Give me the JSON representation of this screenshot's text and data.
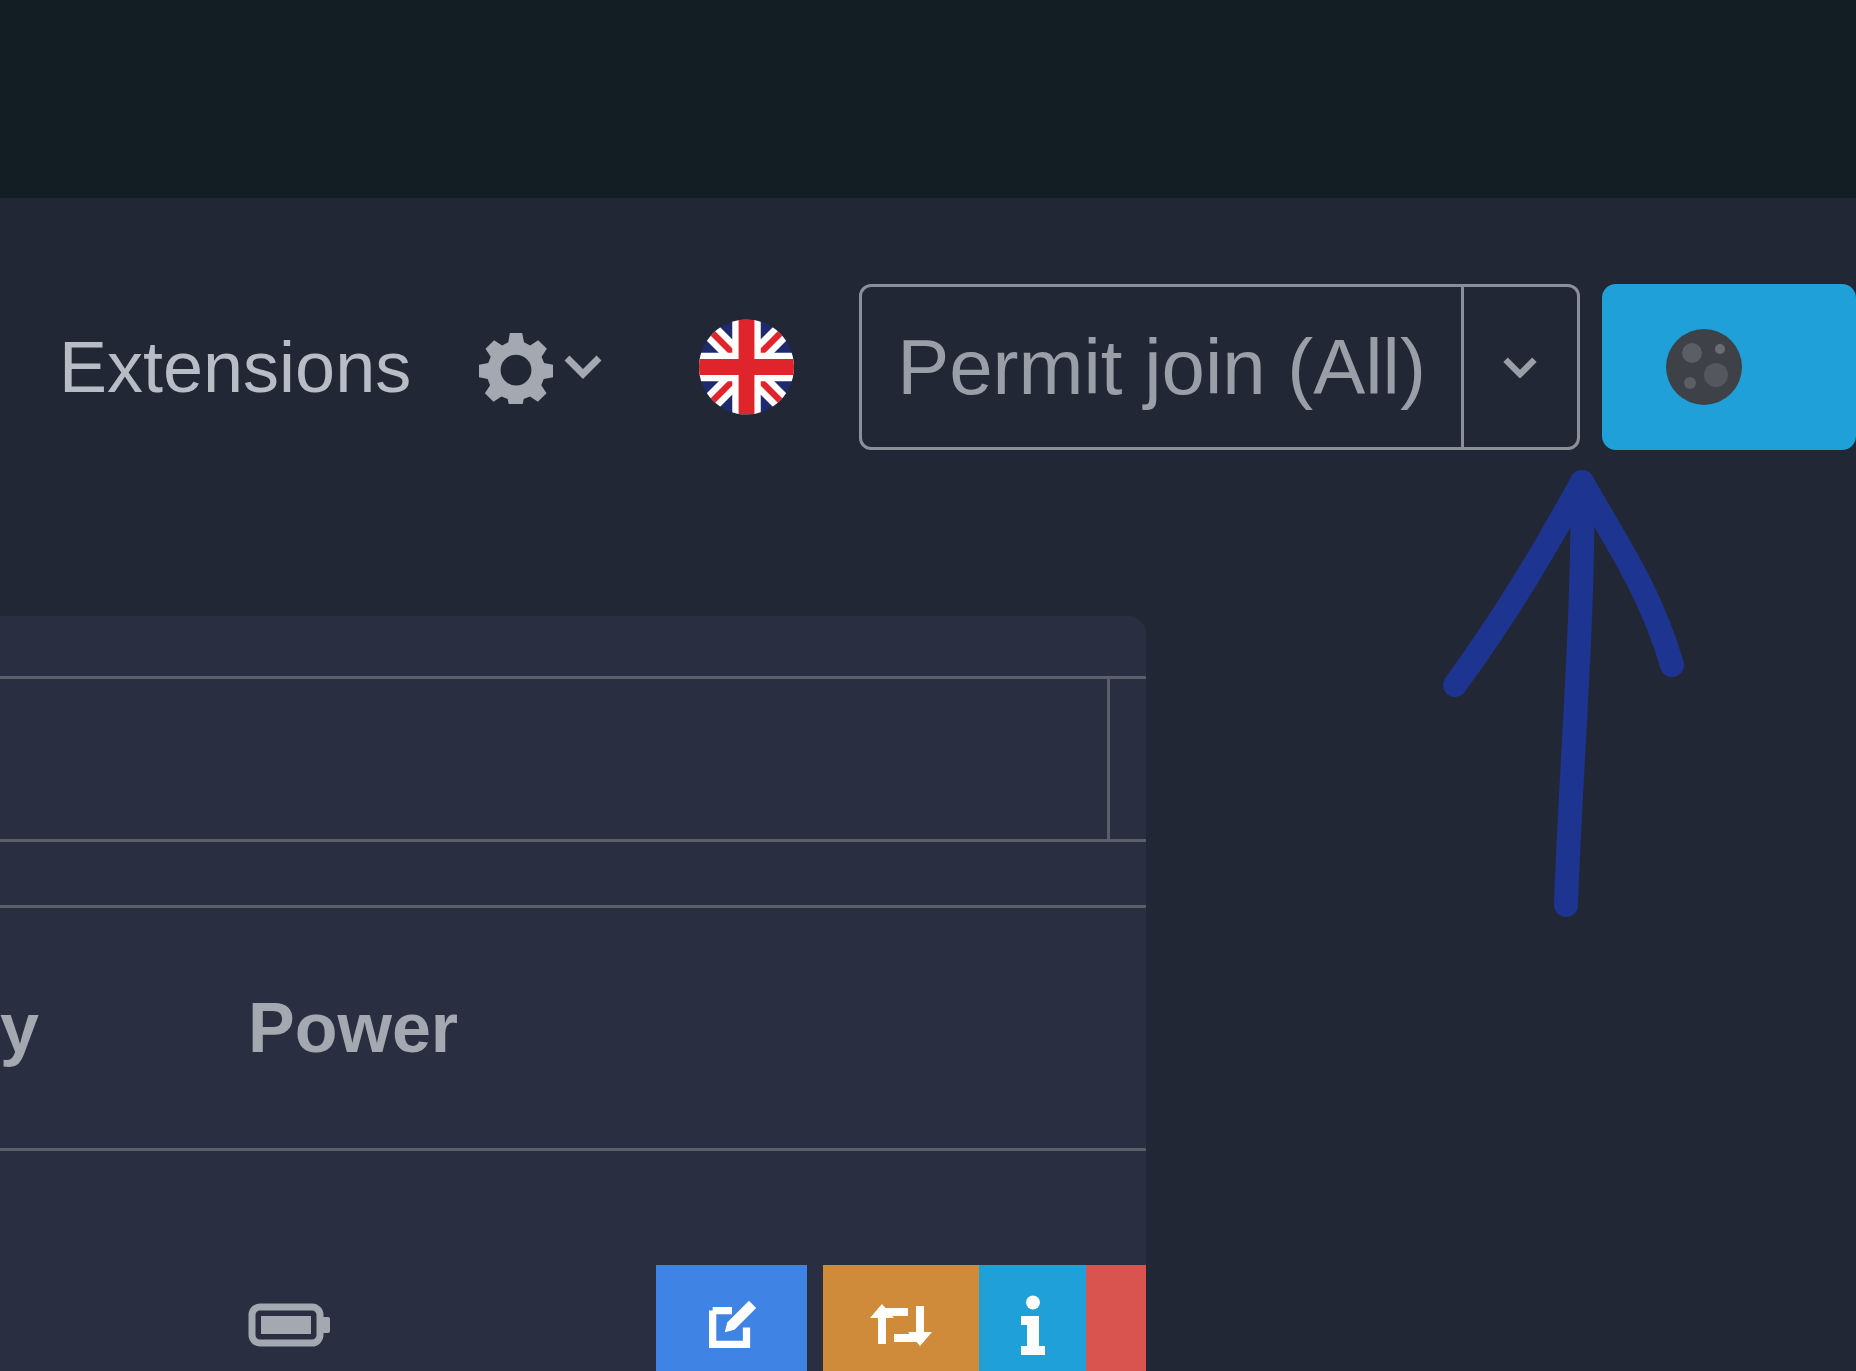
{
  "navbar": {
    "links": [
      {
        "label": "Extensions"
      }
    ],
    "permit_join": {
      "label": "Permit join (All)"
    }
  },
  "table": {
    "columns": [
      "y",
      "Power"
    ],
    "rows": [
      {
        "power": {
          "kind": "battery"
        },
        "actions": [
          {
            "kind": "edit"
          },
          {
            "kind": "rename"
          },
          {
            "kind": "info"
          },
          {
            "kind": "remove"
          }
        ]
      }
    ]
  }
}
